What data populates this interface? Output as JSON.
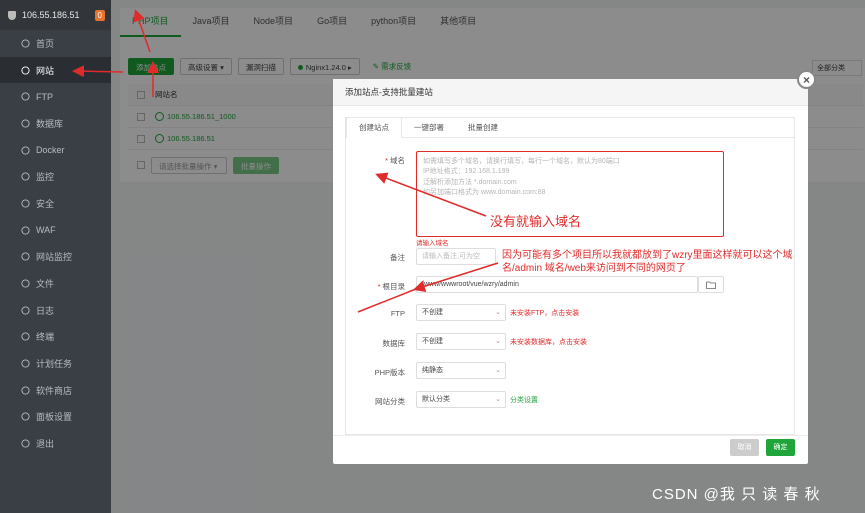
{
  "sidebar": {
    "host": "106.55.186.51",
    "badge": "0",
    "items": [
      {
        "label": "首页",
        "icon": "home-icon"
      },
      {
        "label": "网站",
        "icon": "globe-icon"
      },
      {
        "label": "FTP",
        "icon": "ftp-icon"
      },
      {
        "label": "数据库",
        "icon": "database-icon"
      },
      {
        "label": "Docker",
        "icon": "docker-icon"
      },
      {
        "label": "监控",
        "icon": "monitor-icon"
      },
      {
        "label": "安全",
        "icon": "shield-icon"
      },
      {
        "label": "WAF",
        "icon": "waf-icon"
      },
      {
        "label": "网站监控",
        "icon": "site-monitor-icon"
      },
      {
        "label": "文件",
        "icon": "folder-icon"
      },
      {
        "label": "日志",
        "icon": "log-icon"
      },
      {
        "label": "终端",
        "icon": "terminal-icon"
      },
      {
        "label": "计划任务",
        "icon": "clock-icon"
      },
      {
        "label": "软件商店",
        "icon": "store-icon"
      },
      {
        "label": "面板设置",
        "icon": "gear-icon"
      },
      {
        "label": "退出",
        "icon": "logout-icon"
      }
    ]
  },
  "tabs": [
    "PHP项目",
    "Java项目",
    "Node项目",
    "Go项目",
    "python项目",
    "其他项目"
  ],
  "toolbar": {
    "add_site": "添加站点",
    "advanced": "高级设置",
    "scan": "漏洞扫描",
    "nginx": "Nginx1.24.0",
    "feedback": "需求反馈",
    "category": "全部分类"
  },
  "table": {
    "header": "网站名",
    "rows": [
      "106.55.186.51_1000",
      "106.55.186.51"
    ],
    "batch_select": "请选择批量操作",
    "batch_button": "批量操作"
  },
  "modal": {
    "title": "添加站点-支持批量建站",
    "tabs": [
      "创建站点",
      "一键部署",
      "批量创建"
    ],
    "domain_label": "域名",
    "domain_placeholder": [
      "如需填写多个域名，请换行填写，每行一个域名，默认为80端口",
      "IP地址格式：192.168.1.199",
      "泛解析添加方法 *.domain.com",
      "如另加端口格式为 www.domain.com:88"
    ],
    "domain_error": "请输入域名",
    "remark_label": "备注",
    "remark_placeholder": "请输入备注,可为空",
    "root_label": "根目录",
    "root_value": "/www/wwwroot/vue/wzry/admin",
    "ftp_label": "FTP",
    "ftp_value": "不创建",
    "ftp_warn": "未安装FTP，点击安装",
    "db_label": "数据库",
    "db_value": "不创建",
    "db_warn": "未安装数据库，点击安装",
    "php_label": "PHP版本",
    "php_value": "纯静态",
    "cat_label": "网站分类",
    "cat_value": "默认分类",
    "cat_link": "分类设置",
    "cancel": "取消",
    "confirm": "确定"
  },
  "annotations": {
    "domain_note": "没有就输入域名",
    "root_note": "因为可能有多个项目所以我就都放到了wzry里面这样就可以这个域名/admin 域名/web来访问到不同的网页了"
  },
  "watermark": "CSDN @我 只 读 春 秋",
  "colors": {
    "accent": "#20a53a",
    "annotation": "#e02b2b",
    "sidebar": "#3a3f45"
  }
}
